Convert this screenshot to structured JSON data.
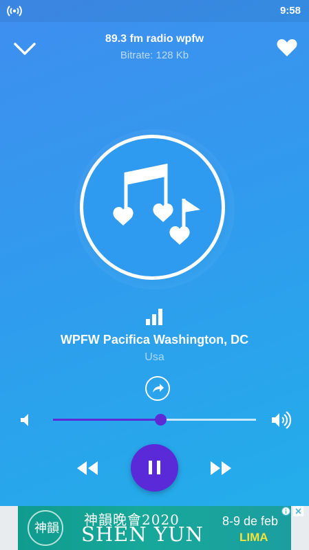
{
  "status_bar": {
    "time": "9:58",
    "icon": "radio-broadcast-icon"
  },
  "header": {
    "title": "89.3 fm radio wpfw",
    "subtitle": "Bitrate: 128 Kb",
    "collapse_icon": "chevron-down-icon",
    "favorite_icon": "heart-icon"
  },
  "artwork": {
    "icon": "music-notes-hearts-icon"
  },
  "station": {
    "signal_icon": "signal-bars-icon",
    "name": "WPFW Pacifica Washington, DC",
    "country": "Usa",
    "share_icon": "share-arrow-icon"
  },
  "volume": {
    "level": 0.53,
    "low_icon": "volume-low-icon",
    "high_icon": "volume-high-icon"
  },
  "controls": {
    "rewind_icon": "rewind-icon",
    "pause_icon": "pause-icon",
    "forward_icon": "fast-forward-icon"
  },
  "ad": {
    "logo_text": "神韻",
    "cjk_title": "神韻晚會2020",
    "title": "SHEN YUN",
    "date": "8-9 de feb",
    "city": "LIMA"
  },
  "colors": {
    "accent": "#5a2ad8",
    "background_top": "#3f8ef0",
    "background_bottom": "#21b0ea"
  }
}
